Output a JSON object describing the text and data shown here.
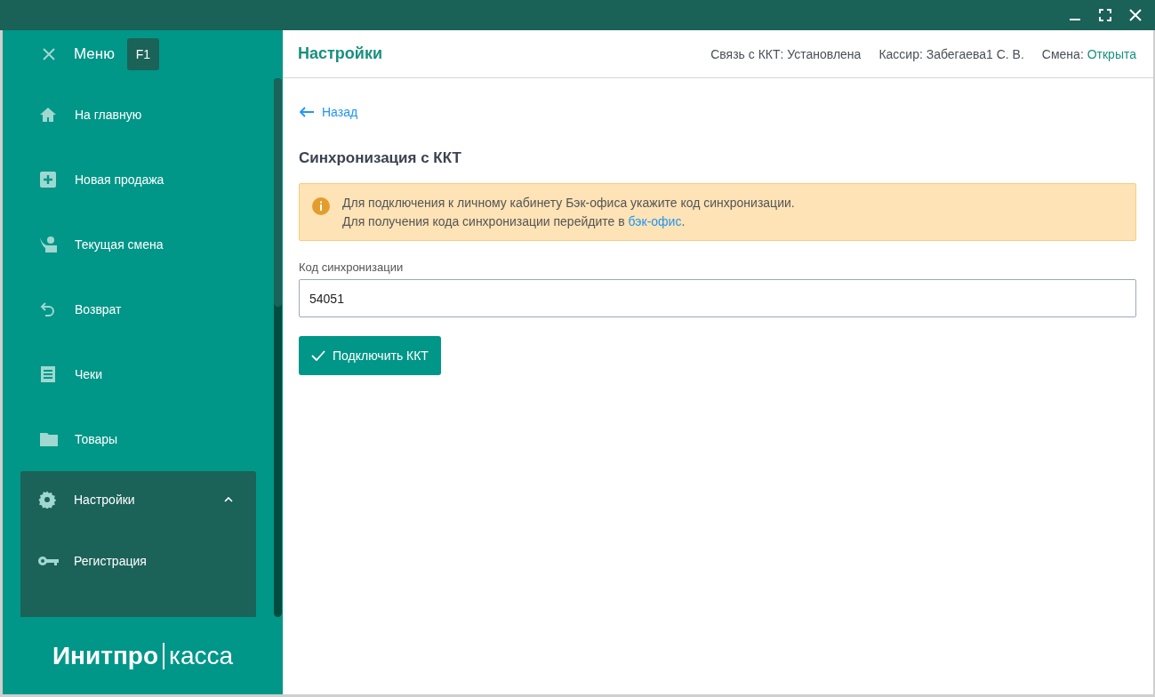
{
  "sidebar": {
    "title": "Меню",
    "shortcut": "F1",
    "items": [
      {
        "label": "На главную",
        "expanded": false
      },
      {
        "label": "Новая продажа",
        "expanded": false
      },
      {
        "label": "Текущая смена",
        "expanded": false
      },
      {
        "label": "Возврат",
        "expanded": false
      },
      {
        "label": "Чеки",
        "expanded": false
      },
      {
        "label": "Товары",
        "expanded": false
      },
      {
        "label": "Настройки",
        "expanded": true,
        "children": [
          {
            "label": "Регистрация"
          }
        ]
      }
    ],
    "logo": {
      "brand": "Инитпро",
      "product": "касса"
    }
  },
  "header": {
    "title": "Настройки",
    "status": [
      {
        "label": "Связь с ККТ:",
        "value": "Установлена",
        "accent": false
      },
      {
        "label": "Кассир:",
        "value": "Забегаева1 С. В.",
        "accent": false
      },
      {
        "label": "Смена:",
        "value": "Открыта",
        "accent": true
      }
    ]
  },
  "back_link": "Назад",
  "section_title": "Синхронизация с ККТ",
  "alert": {
    "lines": [
      "Для подключения к личному кабинету Бэк-офиса укажите код синхронизации."
    ],
    "line2": "Для получения кода синхронизации перейдите в",
    "link": "бэк-офис",
    "tail": "."
  },
  "field": {
    "label": "Код синхронизации",
    "value": "54051"
  },
  "button": "Подключить ККТ"
}
